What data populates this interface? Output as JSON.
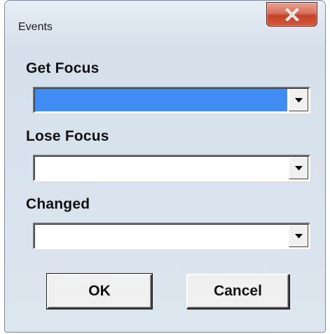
{
  "window": {
    "title": "Events",
    "close_label": "x"
  },
  "fields": [
    {
      "label": "Get Focus",
      "value": "",
      "selected": true
    },
    {
      "label": "Lose Focus",
      "value": "",
      "selected": false
    },
    {
      "label": "Changed",
      "value": "",
      "selected": false
    }
  ],
  "buttons": {
    "ok_label": "OK",
    "cancel_label": "Cancel"
  },
  "colors": {
    "selection": "#3f8df2",
    "dialog_face": "#f0f0f0",
    "close_button": "#c7432a"
  }
}
